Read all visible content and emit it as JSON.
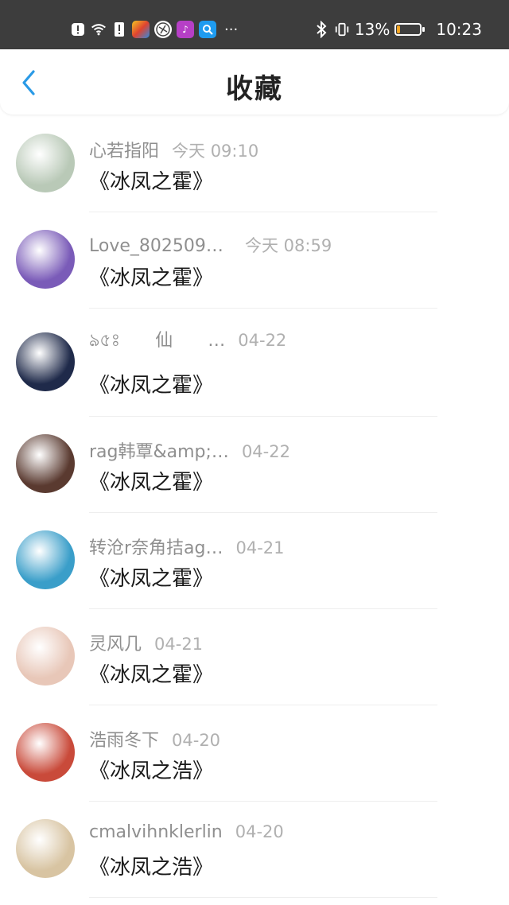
{
  "status_bar": {
    "battery_percent": "13%",
    "battery_level": 0.13,
    "time": "10:23",
    "more": "···",
    "icons": [
      "alert-icon",
      "wifi-icon",
      "sim-alert-icon",
      "app-icon",
      "app-icon",
      "music-app-icon",
      "browser-app-icon",
      "bluetooth-icon",
      "vibrate-icon",
      "battery-icon"
    ]
  },
  "header": {
    "title": "收藏",
    "back_icon": "chevron-left-icon",
    "accent_color": "#2a9ae6"
  },
  "favorites": [
    {
      "name": "心若指阳",
      "time": "今天 09:10",
      "book": "《冰凤之霍》",
      "avatar_color": "#b9c9b7"
    },
    {
      "name": "Love_8025098…",
      "time": "今天 08:59",
      "book": "《冰凤之霍》",
      "avatar_color": "#7a5bb8"
    },
    {
      "name": "ঌ৫ঃ　　仙　　…",
      "time": "04-22",
      "book": "《冰凤之霍》",
      "avatar_color": "#1f2a4a"
    },
    {
      "name": "rag韩覃&amp;…",
      "time": "04-22",
      "book": "《冰凤之霍》",
      "avatar_color": "#5a3a30"
    },
    {
      "name": "转沧r奈角拮ag…",
      "time": "04-21",
      "book": "《冰凤之霍》",
      "avatar_color": "#3a9ec9"
    },
    {
      "name": "灵风几",
      "time": "04-21",
      "book": "《冰凤之霍》",
      "avatar_color": "#e8c7b8"
    },
    {
      "name": "浩雨冬下",
      "time": "04-20",
      "book": "《冰凤之浩》",
      "avatar_color": "#c94a3a"
    },
    {
      "name": "cmalvihnklerlin",
      "time": "04-20",
      "book": "《冰凤之浩》",
      "avatar_color": "#d8c4a2"
    }
  ]
}
